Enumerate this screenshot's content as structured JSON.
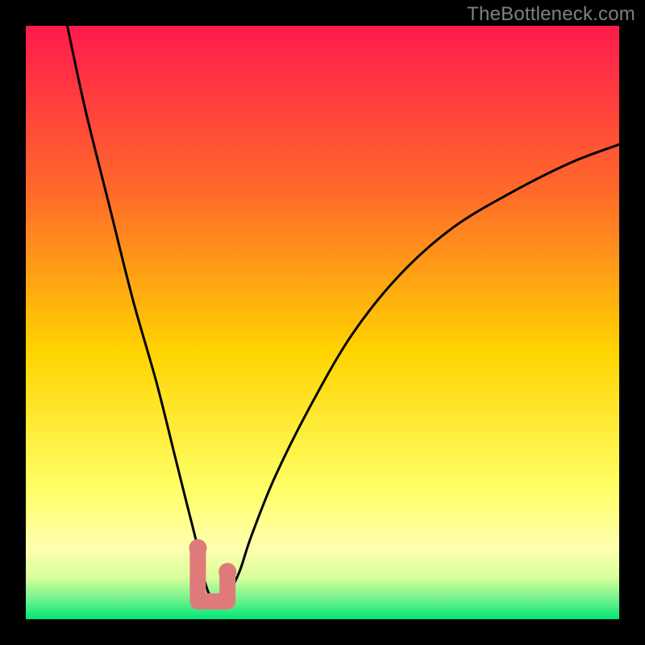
{
  "attribution": "TheBottleneck.com",
  "colors": {
    "bg": "#000000",
    "grad_top": "#ff1a4d",
    "grad_mid1": "#ff7a2a",
    "grad_mid2": "#ffd400",
    "grad_mid3": "#ffff80",
    "grad_band": "#ffffcc",
    "grad_bottom": "#00e676",
    "curve": "#000000",
    "marker": "#e07a7a"
  },
  "chart_data": {
    "type": "line",
    "title": "",
    "xlabel": "",
    "ylabel": "",
    "xlim": [
      0,
      100
    ],
    "ylim": [
      0,
      100
    ],
    "grid": false,
    "legend": false,
    "series": [
      {
        "name": "bottleneck-curve",
        "x": [
          7,
          10,
          14,
          18,
          22,
          25,
          27,
          29,
          30,
          31,
          32,
          33,
          34,
          36,
          38,
          42,
          48,
          55,
          63,
          72,
          82,
          92,
          100
        ],
        "values": [
          100,
          86,
          70,
          54,
          40,
          28,
          20,
          12,
          7,
          4,
          3,
          3,
          4,
          8,
          14,
          24,
          36,
          48,
          58,
          66,
          72,
          77,
          80
        ]
      }
    ],
    "annotations": [
      {
        "name": "marker-left-dot",
        "x": 29,
        "y": 12
      },
      {
        "name": "marker-right-dot",
        "x": 34,
        "y": 8
      },
      {
        "name": "marker-trough",
        "x_range": [
          29,
          34
        ],
        "y": 3
      }
    ]
  }
}
